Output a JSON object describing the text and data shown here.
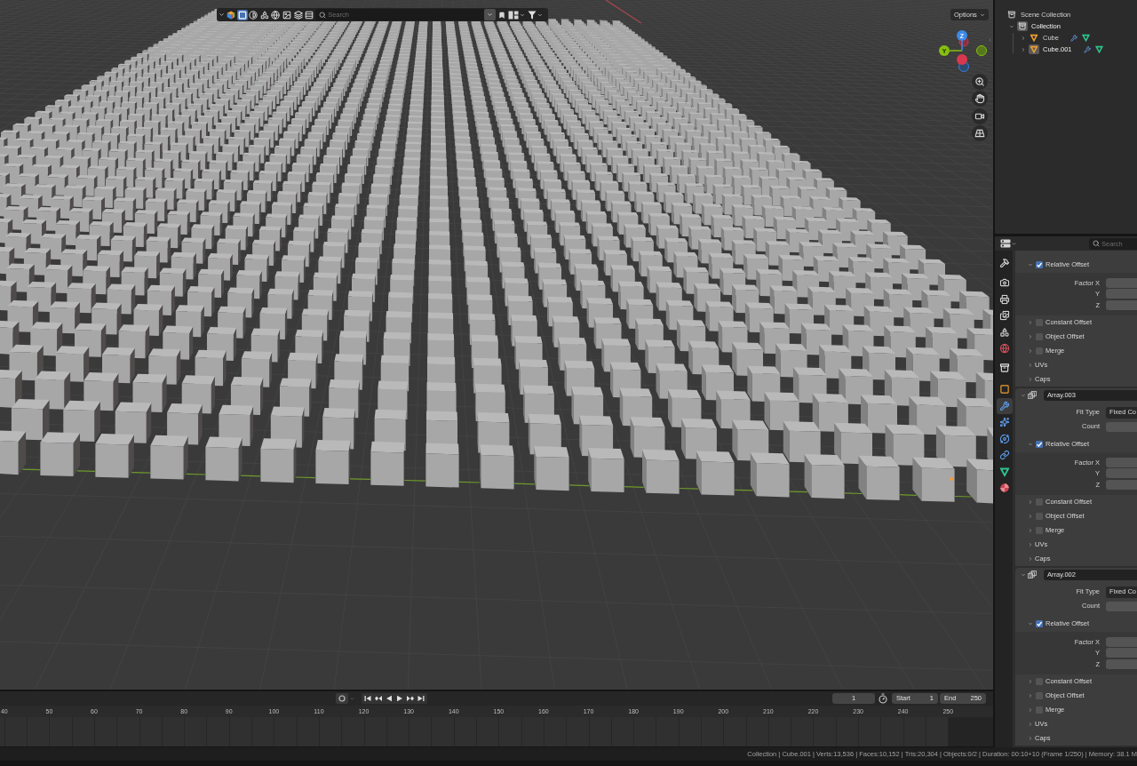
{
  "viewport": {
    "header_buttons": [
      {
        "kind": "scene_cube",
        "selected": false
      },
      {
        "kind": "square",
        "selected": true
      },
      {
        "kind": "half_circle",
        "selected": false
      },
      {
        "kind": "shapes",
        "selected": false
      },
      {
        "kind": "globe",
        "selected": false
      },
      {
        "kind": "image",
        "selected": false
      },
      {
        "kind": "layers",
        "selected": false
      },
      {
        "kind": "rows",
        "selected": false
      }
    ],
    "search": {
      "placeholder": "Search"
    },
    "options_button": {
      "label": "Options"
    },
    "gizmo": {
      "z_label": "Z",
      "y_label": "Y"
    }
  },
  "outliner": {
    "items": [
      {
        "kind": "scene_collection",
        "label": "Scene Collection",
        "active": false,
        "children": [
          {
            "kind": "collection",
            "label": "Collection",
            "expanded": true,
            "active": true,
            "children": [
              {
                "kind": "object",
                "label": "Cube",
                "expanded": false,
                "active": false
              },
              {
                "kind": "object",
                "label": "Cube.001",
                "expanded": false,
                "active": true
              }
            ]
          }
        ]
      }
    ]
  },
  "properties": {
    "search": {
      "placeholder": "Search"
    },
    "tabs": [
      {
        "kind": "tool",
        "selected": false
      },
      {
        "kind": "render",
        "selected": false
      },
      {
        "kind": "output",
        "selected": false
      },
      {
        "kind": "view_layer",
        "selected": false
      },
      {
        "kind": "scene",
        "selected": false
      },
      {
        "kind": "world",
        "selected": false
      },
      {
        "kind": "collection",
        "selected": false
      },
      {
        "kind": "object",
        "selected": false
      },
      {
        "kind": "modifier",
        "selected": true
      },
      {
        "kind": "particles",
        "selected": false
      },
      {
        "kind": "physics",
        "selected": false
      },
      {
        "kind": "constraints",
        "selected": false
      },
      {
        "kind": "data",
        "selected": false
      },
      {
        "kind": "material",
        "selected": false
      }
    ],
    "continued_panel": {
      "subpanels": [
        {
          "kind": "toggle",
          "label": "Relative Offset",
          "checked": true,
          "expanded": true,
          "fields": [
            {
              "kind": "number",
              "label": "Factor X"
            },
            {
              "kind": "number",
              "label": "Y"
            },
            {
              "kind": "number",
              "label": "Z"
            }
          ]
        },
        {
          "kind": "toggle",
          "label": "Constant Offset",
          "checked": false,
          "expanded": false
        },
        {
          "kind": "toggle",
          "label": "Object Offset",
          "checked": false,
          "expanded": false
        },
        {
          "kind": "toggle",
          "label": "Merge",
          "checked": false,
          "expanded": false
        },
        {
          "kind": "plain",
          "label": "UVs",
          "expanded": false
        },
        {
          "kind": "plain",
          "label": "Caps",
          "expanded": false
        }
      ]
    },
    "modifiers": [
      {
        "name": "Array.003",
        "expanded": true,
        "fields": [
          {
            "kind": "dropdown",
            "label": "Fit Type",
            "value": "Fixed Co"
          },
          {
            "kind": "number",
            "label": "Count"
          }
        ],
        "subpanels": [
          {
            "kind": "toggle",
            "label": "Relative Offset",
            "checked": true,
            "expanded": true,
            "fields": [
              {
                "kind": "number",
                "label": "Factor X"
              },
              {
                "kind": "number",
                "label": "Y"
              },
              {
                "kind": "number",
                "label": "Z"
              }
            ]
          },
          {
            "kind": "toggle",
            "label": "Constant Offset",
            "checked": false,
            "expanded": false
          },
          {
            "kind": "toggle",
            "label": "Object Offset",
            "checked": false,
            "expanded": false
          },
          {
            "kind": "toggle",
            "label": "Merge",
            "checked": false,
            "expanded": false
          },
          {
            "kind": "plain",
            "label": "UVs",
            "expanded": false
          },
          {
            "kind": "plain",
            "label": "Caps",
            "expanded": false
          }
        ]
      },
      {
        "name": "Array.002",
        "expanded": true,
        "fields": [
          {
            "kind": "dropdown",
            "label": "Fit Type",
            "value": "Fixed Co"
          },
          {
            "kind": "number",
            "label": "Count"
          }
        ],
        "subpanels": [
          {
            "kind": "toggle",
            "label": "Relative Offset",
            "checked": true,
            "expanded": true,
            "fields": [
              {
                "kind": "number",
                "label": "Factor X"
              },
              {
                "kind": "number",
                "label": "Y"
              },
              {
                "kind": "number",
                "label": "Z"
              }
            ]
          },
          {
            "kind": "toggle",
            "label": "Constant Offset",
            "checked": false,
            "expanded": false
          },
          {
            "kind": "toggle",
            "label": "Object Offset",
            "checked": false,
            "expanded": false
          },
          {
            "kind": "toggle",
            "label": "Merge",
            "checked": false,
            "expanded": false
          },
          {
            "kind": "plain",
            "label": "UVs",
            "expanded": false
          },
          {
            "kind": "plain",
            "label": "Caps",
            "expanded": false
          }
        ]
      }
    ]
  },
  "timeline": {
    "current_frame": "1",
    "start": {
      "label": "Start",
      "value": "1"
    },
    "end": {
      "label": "End",
      "value": "250"
    },
    "ruler": [
      "40",
      "50",
      "60",
      "70",
      "80",
      "90",
      "100",
      "110",
      "120",
      "130",
      "140",
      "150",
      "160",
      "170",
      "180",
      "190",
      "200",
      "210",
      "220",
      "230",
      "240",
      "250"
    ]
  },
  "status_bar": {
    "text": "Collection | Cube.001 | Verts:13,536 | Faces:10,152 | Tris:20,304 | Objects:0/2 | Duration: 00:10+10 (Frame 1/250) | Memory: 38.1 M"
  }
}
